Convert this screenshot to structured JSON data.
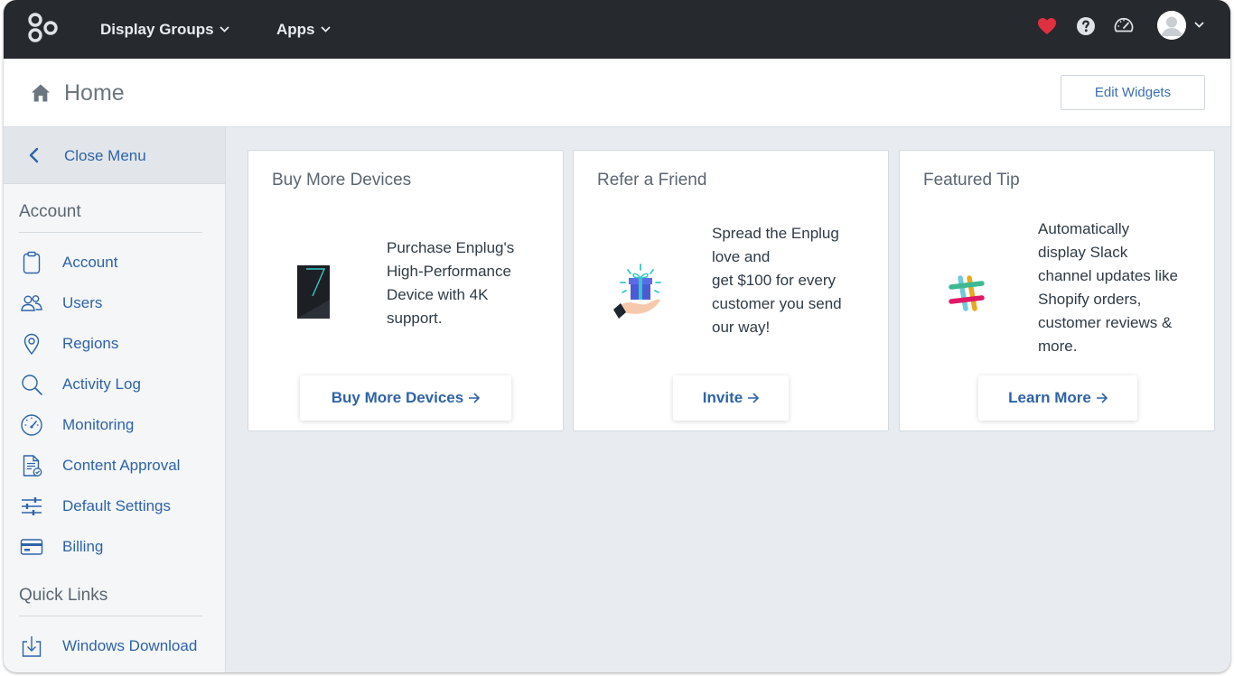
{
  "topbar": {
    "nav": [
      {
        "label": "Display Groups"
      },
      {
        "label": "Apps"
      }
    ],
    "icons": [
      "logo-icon",
      "heart-icon",
      "help-icon",
      "speedometer-icon",
      "avatar"
    ],
    "background": "#26292d"
  },
  "header": {
    "title": "Home",
    "edit_widgets_label": "Edit Widgets"
  },
  "sidebar": {
    "close_menu_label": "Close Menu",
    "account_section_title": "Account",
    "items": [
      {
        "label": "Account",
        "icon": "clipboard-icon"
      },
      {
        "label": "Users",
        "icon": "users-icon"
      },
      {
        "label": "Regions",
        "icon": "map-pin-icon"
      },
      {
        "label": "Activity Log",
        "icon": "search-icon"
      },
      {
        "label": "Monitoring",
        "icon": "speedometer-icon"
      },
      {
        "label": "Content Approval",
        "icon": "document-check-icon"
      },
      {
        "label": "Default Settings",
        "icon": "sliders-icon"
      },
      {
        "label": "Billing",
        "icon": "credit-card-icon"
      }
    ],
    "quick_links_title": "Quick Links",
    "quick_links": [
      {
        "label": "Windows Download",
        "icon": "download-icon"
      }
    ]
  },
  "cards": [
    {
      "title": "Buy More Devices",
      "lines": [
        "Purchase Enplug's",
        "High-Performance",
        "Device with 4K",
        "support."
      ],
      "cta": "Buy More Devices",
      "illustration": "device-image"
    },
    {
      "title": "Refer a Friend",
      "lines": [
        "Spread the Enplug",
        "love and",
        "get $100 for every",
        "customer you send",
        "our way!"
      ],
      "cta": "Invite",
      "illustration": "gift-hand-image"
    },
    {
      "title": "Featured Tip",
      "lines": [
        "Automatically",
        "display Slack",
        "channel updates like",
        "Shopify orders,",
        "customer reviews &",
        "more."
      ],
      "cta": "Learn More",
      "illustration": "slack-logo-image"
    }
  ],
  "colors": {
    "accent": "#2f63a8",
    "heart": "#e0303f",
    "content_bg": "#e8ecf0"
  }
}
